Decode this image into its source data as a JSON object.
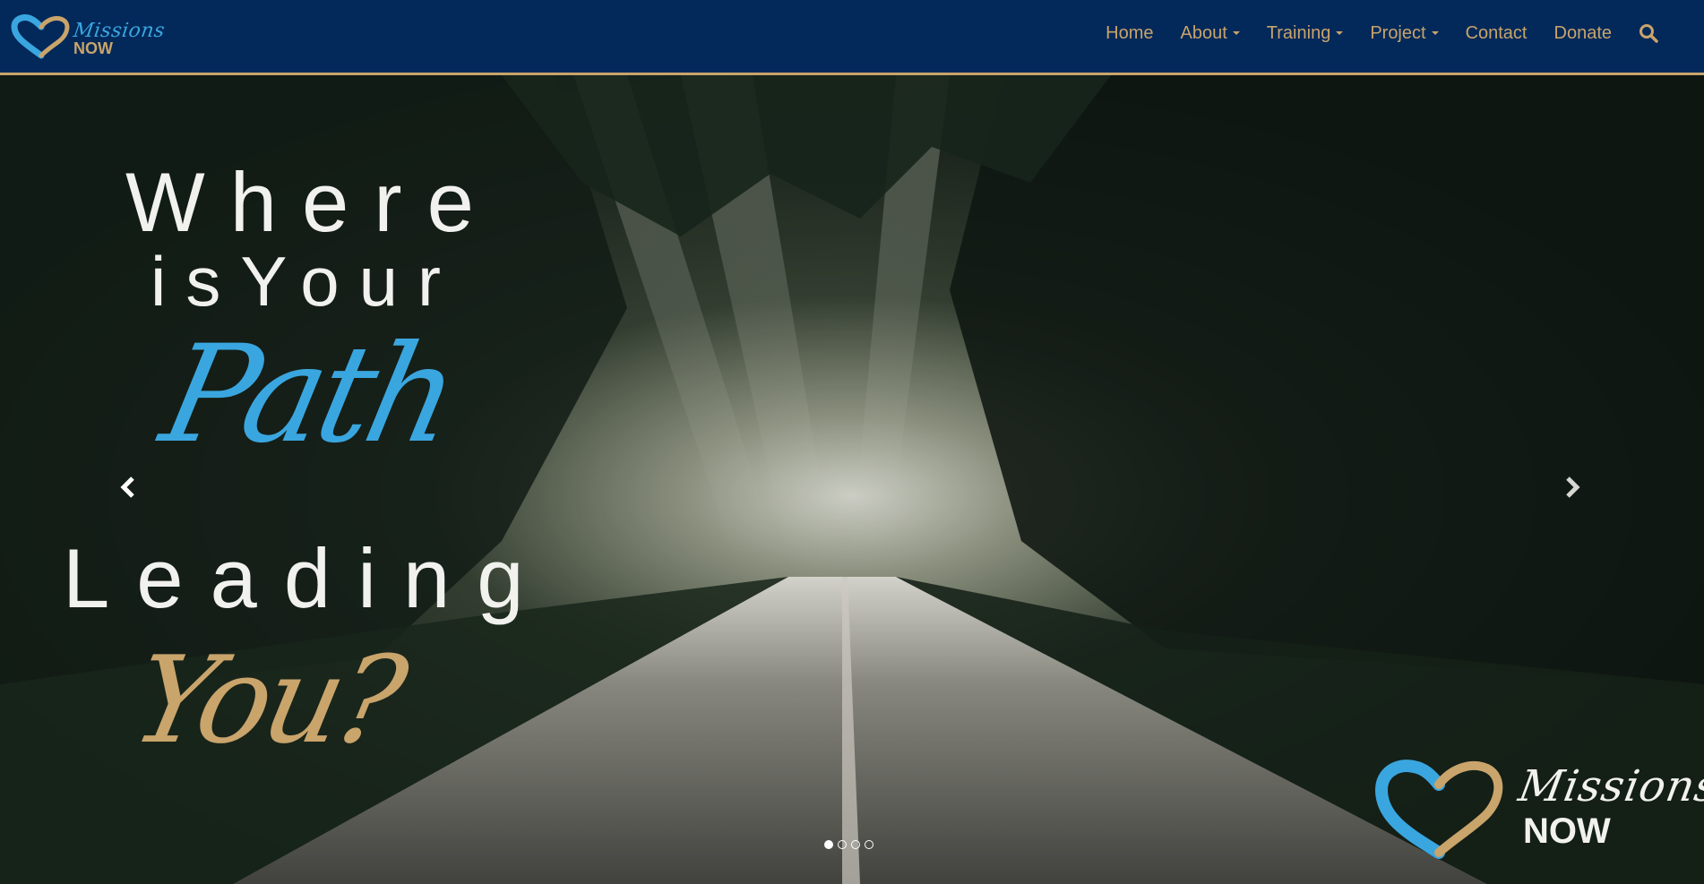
{
  "brand": {
    "script": "Missions",
    "now": "NOW"
  },
  "nav": {
    "items": [
      {
        "label": "Home",
        "dropdown": false
      },
      {
        "label": "About",
        "dropdown": true
      },
      {
        "label": "Training",
        "dropdown": true
      },
      {
        "label": "Project",
        "dropdown": true
      },
      {
        "label": "Contact",
        "dropdown": false
      },
      {
        "label": "Donate",
        "dropdown": false
      }
    ],
    "search_icon": "search-icon"
  },
  "hero": {
    "headline": {
      "line1": "Where",
      "line2": "isYour",
      "line3": "Path",
      "line4": "Leading",
      "line5": "You?"
    },
    "prev_icon": "chevron-left-icon",
    "next_icon": "chevron-right-icon",
    "indicators": {
      "count": 4,
      "active": 1
    },
    "logo": {
      "script": "Missions",
      "now": "NOW"
    }
  },
  "colors": {
    "navbar": "#02295a",
    "gold": "#c9a46b",
    "blue": "#3aa6df",
    "white": "#f1f1ee"
  }
}
